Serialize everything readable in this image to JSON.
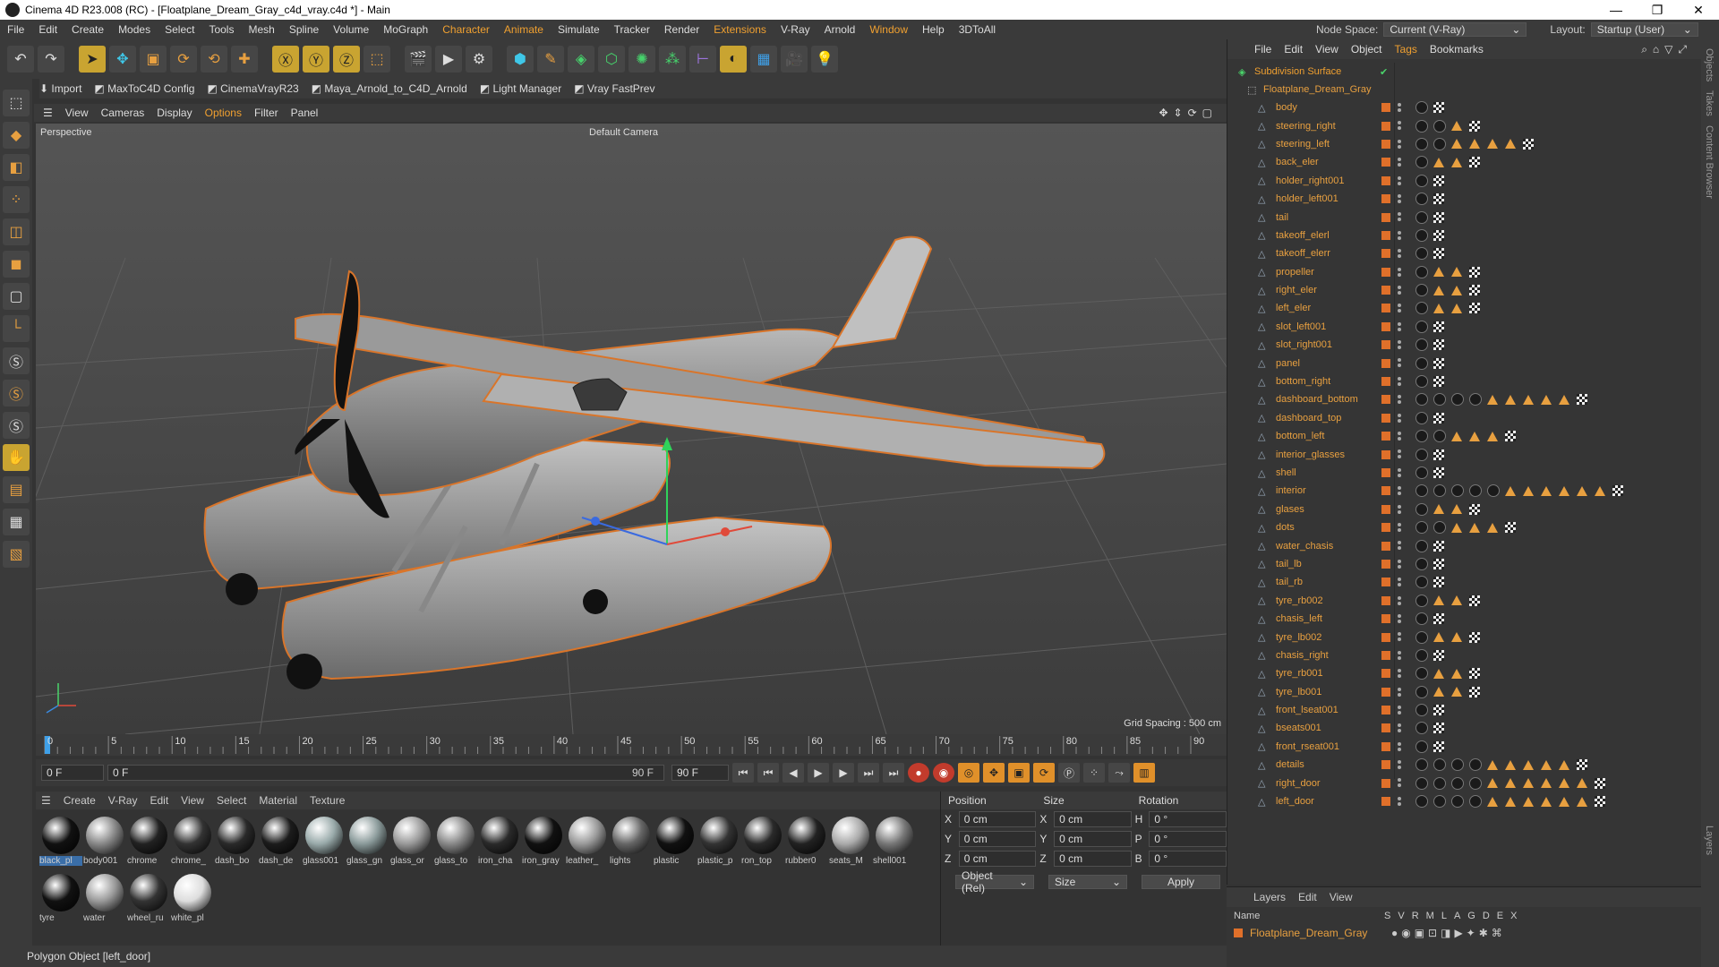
{
  "window": {
    "title": "Cinema 4D R23.008 (RC) - [Floatplane_Dream_Gray_c4d_vray.c4d *] - Main",
    "minimize": "—",
    "maximize": "❐",
    "close": "✕"
  },
  "menu": [
    "File",
    "Edit",
    "Create",
    "Modes",
    "Select",
    "Tools",
    "Mesh",
    "Spline",
    "Volume",
    "MoGraph",
    "Character",
    "Animate",
    "Simulate",
    "Tracker",
    "Render",
    "Extensions",
    "V-Ray",
    "Arnold",
    "Window",
    "Help",
    "3DToAll"
  ],
  "node_space": {
    "label": "Node Space:",
    "value": "Current (V-Ray)"
  },
  "layout": {
    "label": "Layout:",
    "value": "Startup (User)"
  },
  "plugins": {
    "import": "Import",
    "maxtoc4d": "MaxToC4D Config",
    "cinemavray": "CinemaVrayR23",
    "maya_arnold": "Maya_Arnold_to_C4D_Arnold",
    "light_manager": "Light Manager",
    "vray_fastprev": "Vray FastPrev"
  },
  "viewport_menu": [
    "View",
    "Cameras",
    "Display",
    "Options",
    "Filter",
    "Panel"
  ],
  "viewport": {
    "name": "Perspective",
    "camera": "Default Camera",
    "grid_spacing": "Grid Spacing : 500 cm"
  },
  "timeline": {
    "ticks": [
      "0",
      "5",
      "10",
      "15",
      "20",
      "25",
      "30",
      "35",
      "40",
      "45",
      "50",
      "55",
      "60",
      "65",
      "70",
      "75",
      "80",
      "85",
      "90"
    ],
    "current": "0 F",
    "start": "0 F",
    "start2": "0 F",
    "end": "90 F",
    "end2": "90 F"
  },
  "material_menu": [
    "Create",
    "V-Ray",
    "Edit",
    "View",
    "Select",
    "Material",
    "Texture"
  ],
  "materials": [
    {
      "name": "black_pl",
      "color": "#111"
    },
    {
      "name": "body001",
      "color": "#888"
    },
    {
      "name": "chrome",
      "color": "#222"
    },
    {
      "name": "chrome_",
      "color": "#333"
    },
    {
      "name": "dash_bo",
      "color": "#2a2a2a"
    },
    {
      "name": "dash_de",
      "color": "#1c1c1c"
    },
    {
      "name": "glass001",
      "color": "#9aa"
    },
    {
      "name": "glass_gn",
      "color": "#8a9a9a"
    },
    {
      "name": "glass_or",
      "color": "#999"
    },
    {
      "name": "glass_to",
      "color": "#888"
    },
    {
      "name": "iron_cha",
      "color": "#2a2a2a"
    },
    {
      "name": "iron_gray",
      "color": "#111"
    },
    {
      "name": "leather_",
      "color": "#999"
    },
    {
      "name": "lights",
      "color": "#666"
    },
    {
      "name": "plastic",
      "color": "#111"
    },
    {
      "name": "plastic_p",
      "color": "#333"
    },
    {
      "name": "ron_top",
      "color": "#2a2a2a"
    },
    {
      "name": "rubber0",
      "color": "#222"
    },
    {
      "name": "seats_M",
      "color": "#aaa"
    },
    {
      "name": "shell001",
      "color": "#777"
    },
    {
      "name": "tyre",
      "color": "#111"
    },
    {
      "name": "water",
      "color": "#999"
    },
    {
      "name": "wheel_ru",
      "color": "#333"
    },
    {
      "name": "white_pl",
      "color": "#ddd"
    }
  ],
  "attributes": {
    "headers": [
      "Position",
      "Size",
      "Rotation"
    ],
    "rows": [
      {
        "a": "X",
        "pos": "0 cm",
        "b": "X",
        "size": "0 cm",
        "c": "H",
        "rot": "0 °"
      },
      {
        "a": "Y",
        "pos": "0 cm",
        "b": "Y",
        "size": "0 cm",
        "c": "P",
        "rot": "0 °"
      },
      {
        "a": "Z",
        "pos": "0 cm",
        "b": "Z",
        "size": "0 cm",
        "c": "B",
        "rot": "0 °"
      }
    ],
    "coord_mode": "Object (Rel)",
    "size_mode": "Size",
    "apply": "Apply"
  },
  "status": "Polygon Object [left_door]",
  "object_menu": [
    "File",
    "Edit",
    "View",
    "Object",
    "Tags",
    "Bookmarks"
  ],
  "objects": {
    "root": "Subdivision Surface",
    "group": "Floatplane_Dream_Gray",
    "items": [
      {
        "name": "body",
        "tags": "sc"
      },
      {
        "name": "steering_right",
        "tags": "sstc"
      },
      {
        "name": "steering_left",
        "tags": "ssttttc"
      },
      {
        "name": "back_eler",
        "tags": "sttc"
      },
      {
        "name": "holder_right001",
        "tags": "sc"
      },
      {
        "name": "holder_left001",
        "tags": "sc"
      },
      {
        "name": "tail",
        "tags": "sc"
      },
      {
        "name": "takeoff_elerl",
        "tags": "sc"
      },
      {
        "name": "takeoff_elerr",
        "tags": "sc"
      },
      {
        "name": "propeller",
        "tags": "sttc"
      },
      {
        "name": "right_eler",
        "tags": "sttc"
      },
      {
        "name": "left_eler",
        "tags": "sttc"
      },
      {
        "name": "slot_left001",
        "tags": "sc"
      },
      {
        "name": "slot_right001",
        "tags": "sc"
      },
      {
        "name": "panel",
        "tags": "sc"
      },
      {
        "name": "bottom_right",
        "tags": "sc"
      },
      {
        "name": "dashboard_bottom",
        "tags": "sssstttttc"
      },
      {
        "name": "dashboard_top",
        "tags": "sc"
      },
      {
        "name": "bottom_left",
        "tags": "sstttc"
      },
      {
        "name": "interior_glasses",
        "tags": "sc"
      },
      {
        "name": "shell",
        "tags": "sc"
      },
      {
        "name": "interior",
        "tags": "sssssttttttc"
      },
      {
        "name": "glases",
        "tags": "sttc"
      },
      {
        "name": "dots",
        "tags": "sstttc"
      },
      {
        "name": "water_chasis",
        "tags": "sc"
      },
      {
        "name": "tail_lb",
        "tags": "sc"
      },
      {
        "name": "tail_rb",
        "tags": "sc"
      },
      {
        "name": "tyre_rb002",
        "tags": "sttc"
      },
      {
        "name": "chasis_left",
        "tags": "sc"
      },
      {
        "name": "tyre_lb002",
        "tags": "sttc"
      },
      {
        "name": "chasis_right",
        "tags": "sc"
      },
      {
        "name": "tyre_rb001",
        "tags": "sttc"
      },
      {
        "name": "tyre_lb001",
        "tags": "sttc"
      },
      {
        "name": "front_lseat001",
        "tags": "sc"
      },
      {
        "name": "bseats001",
        "tags": "sc"
      },
      {
        "name": "front_rseat001",
        "tags": "sc"
      },
      {
        "name": "details",
        "tags": "sssstttttc"
      },
      {
        "name": "right_door",
        "tags": "ssssttttttc"
      },
      {
        "name": "left_door",
        "tags": "ssssttttttc"
      }
    ]
  },
  "layers": {
    "menu": [
      "Layers",
      "Edit",
      "View"
    ],
    "columns": [
      "Name",
      "S",
      "V",
      "R",
      "M",
      "L",
      "A",
      "G",
      "D",
      "E",
      "X"
    ],
    "row": "Floatplane_Dream_Gray"
  },
  "side_tabs": [
    "Objects",
    "Takes",
    "Content Browser",
    "Layers"
  ]
}
